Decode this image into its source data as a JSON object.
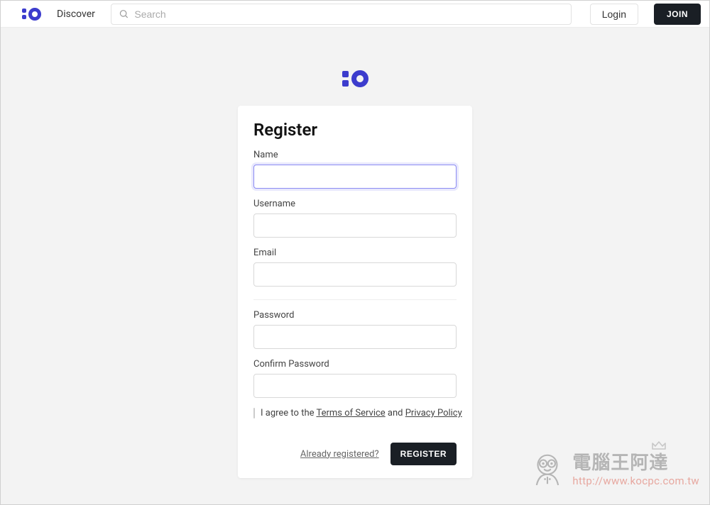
{
  "nav": {
    "discover_label": "Discover",
    "search_placeholder": "Search",
    "login_label": "Login",
    "join_label": "JOIN"
  },
  "register": {
    "heading": "Register",
    "name_label": "Name",
    "username_label": "Username",
    "email_label": "Email",
    "password_label": "Password",
    "confirm_password_label": "Confirm Password",
    "agree_prefix": "I agree to the ",
    "tos_label": "Terms of Service",
    "agree_middle": " and ",
    "privacy_label": "Privacy Policy",
    "already_label": "Already registered?",
    "submit_label": "REGISTER"
  },
  "watermark": {
    "title": "電腦王阿達",
    "url": "http://www.kocpc.com.tw"
  }
}
